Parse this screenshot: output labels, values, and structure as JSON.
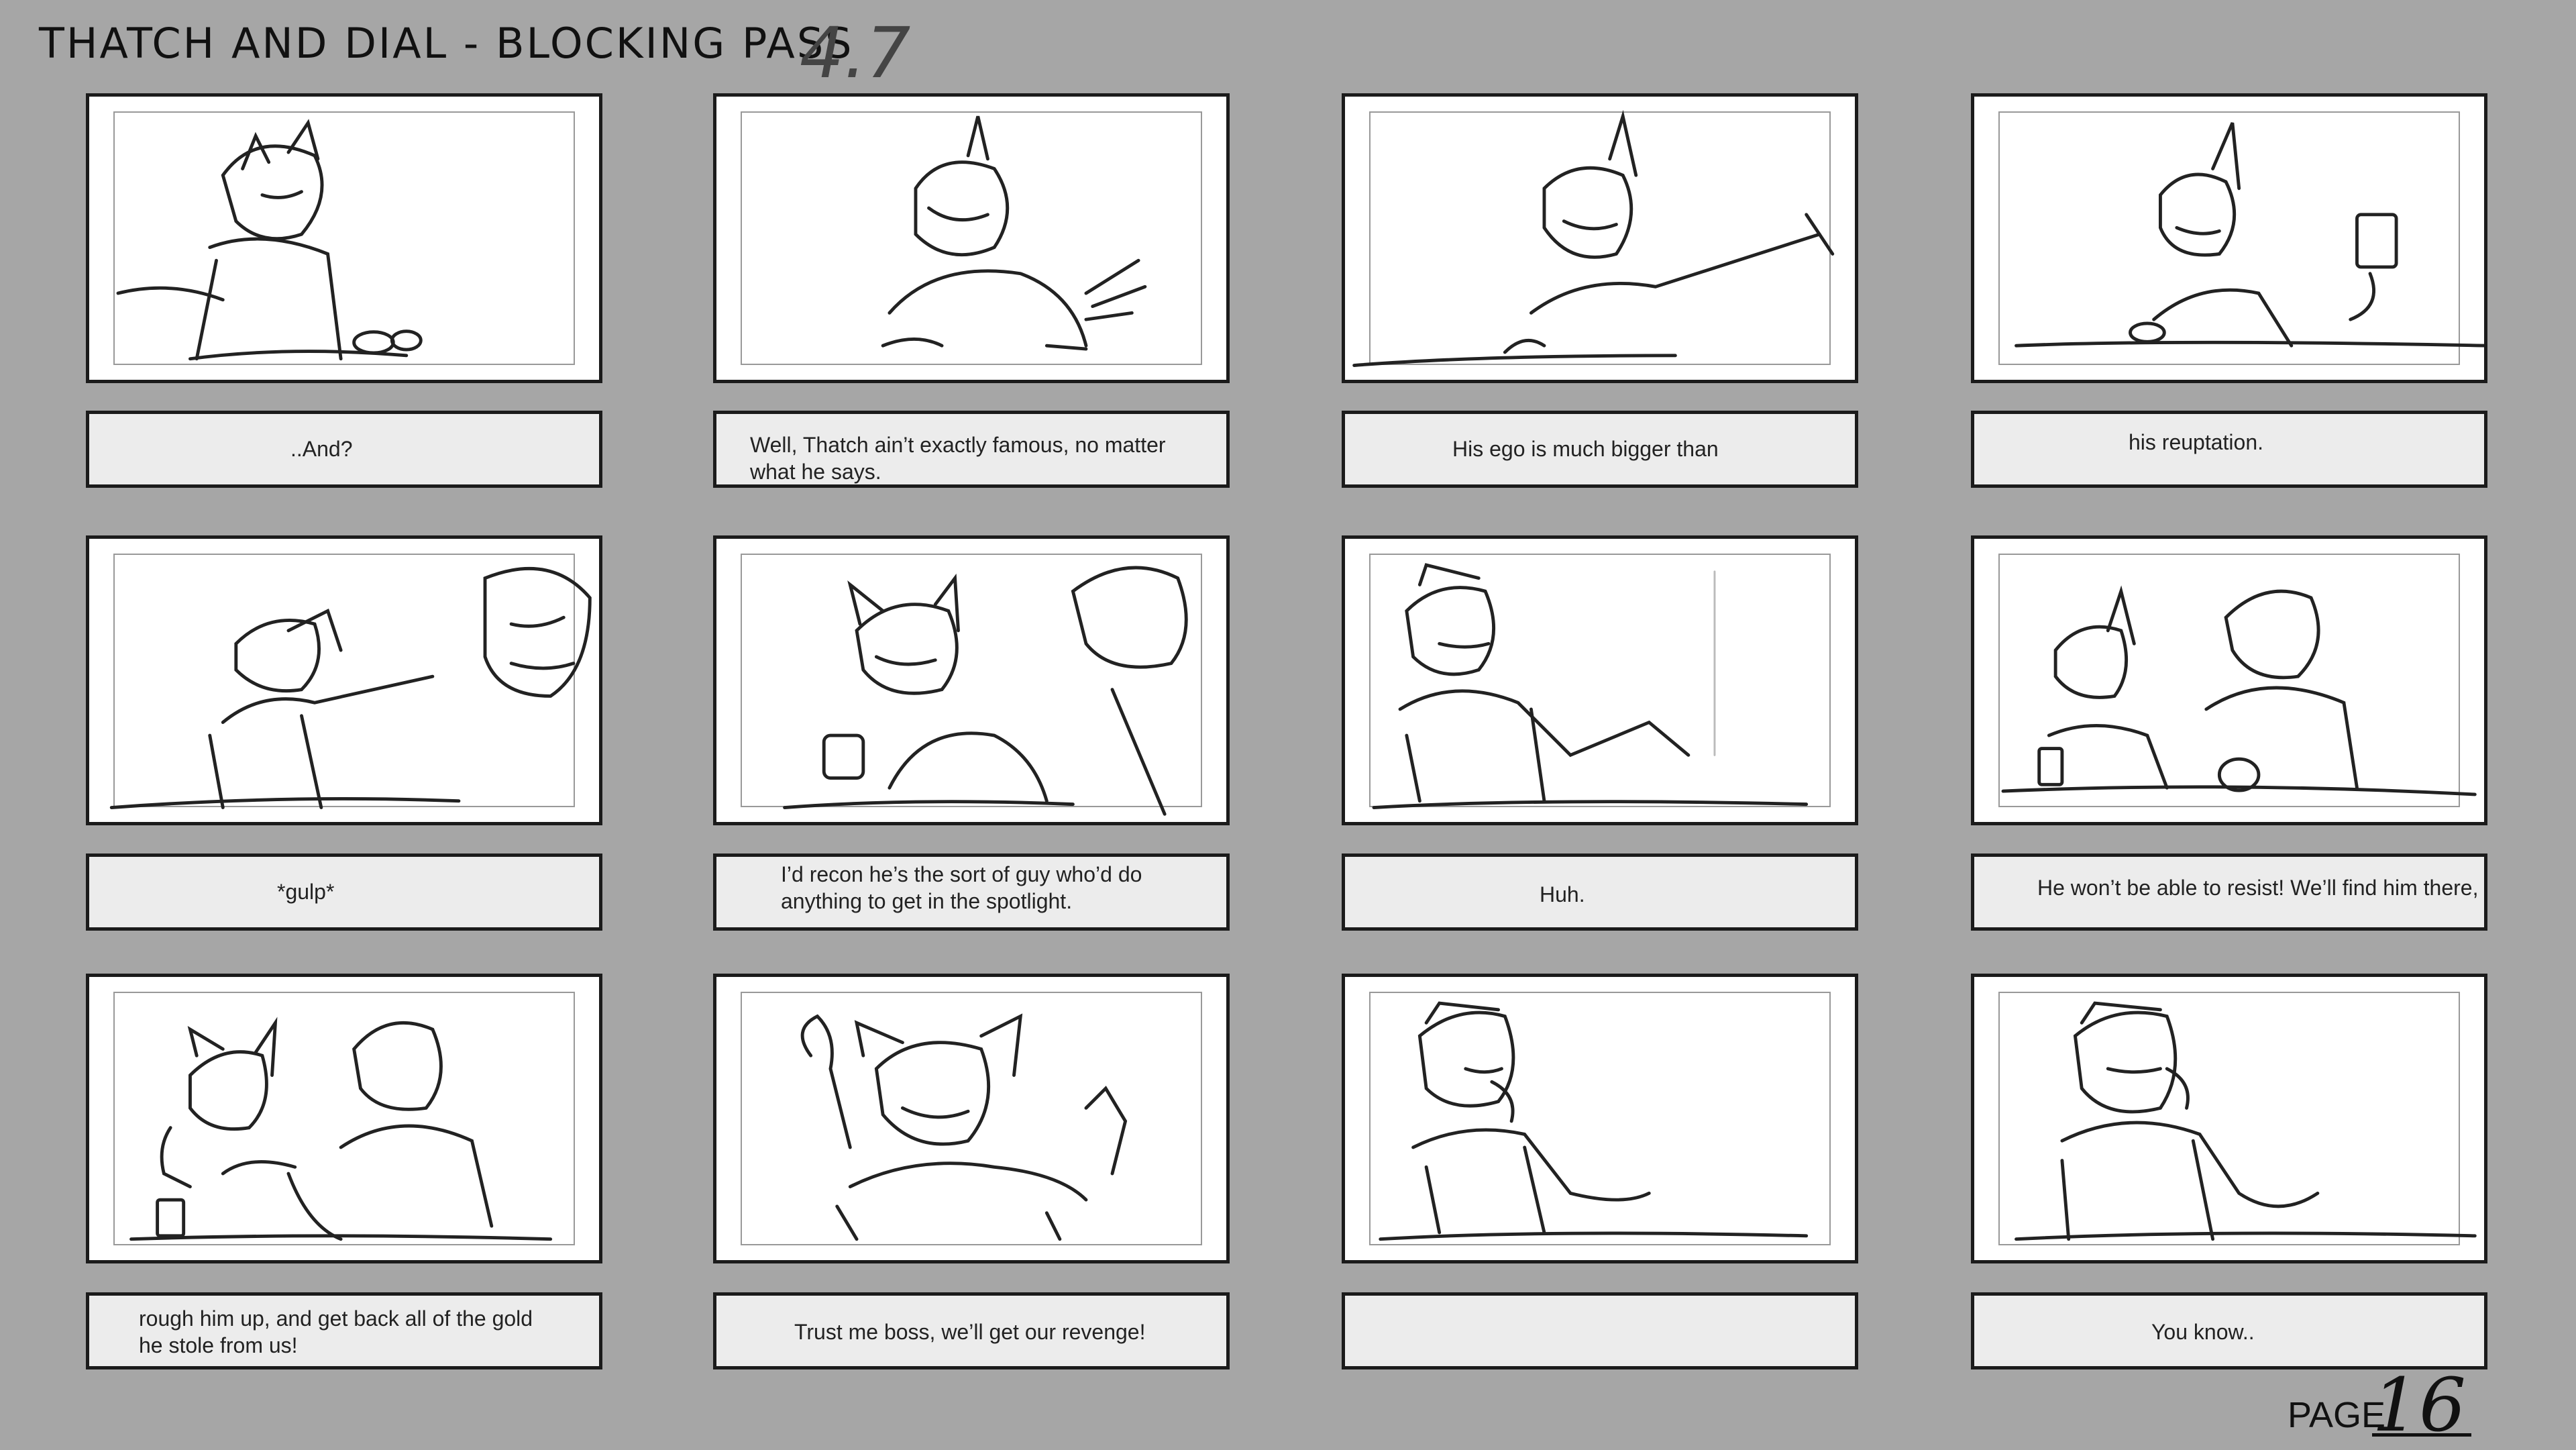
{
  "header": {
    "title": "THATCH AND DIAL - BLOCKING PASS",
    "version": "4.7"
  },
  "panels": [
    {
      "caption": "..And?"
    },
    {
      "caption": "Well, Thatch ain’t exactly famous, no matter\nwhat he says."
    },
    {
      "caption": "His ego is much bigger than"
    },
    {
      "caption": "his reuptation."
    },
    {
      "caption": "*gulp*"
    },
    {
      "caption": "I’d recon he’s the sort of guy who’d do\nanything to get in the spotlight."
    },
    {
      "caption": "Huh."
    },
    {
      "caption": "He won’t be able to resist! We’ll find him there,"
    },
    {
      "caption": "rough him up, and get back all of the gold\nhe stole from us!"
    },
    {
      "caption": "Trust me boss, we’ll get our revenge!"
    },
    {
      "caption": ""
    },
    {
      "caption": "You know.."
    }
  ],
  "footer": {
    "page_label": "PAGE",
    "page_number": "16"
  },
  "colors": {
    "background": "#a6a6a6",
    "panel": "#ffffff",
    "caption_box": "#ececec",
    "ink": "#1b1b1b"
  }
}
